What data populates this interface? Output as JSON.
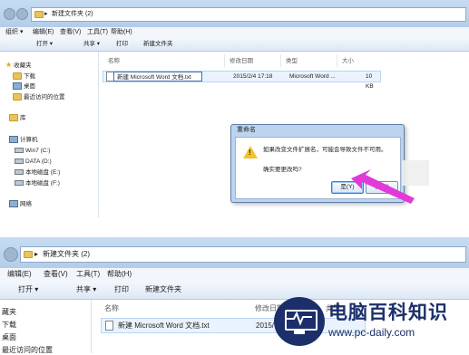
{
  "top": {
    "breadcrumb": "新建文件夹 (2)",
    "menu": [
      "组织 ▾",
      "编辑(E)",
      "查看(V)",
      "工具(T)",
      "帮助(H)"
    ],
    "toolbar": {
      "open": "打开 ▾",
      "share": "共享 ▾",
      "print": "打印",
      "new_folder": "新建文件夹"
    },
    "sidebar": {
      "favorites": "收藏夹",
      "downloads": "下载",
      "desktop": "桌面",
      "recent": "最近访问的位置",
      "libraries": "库",
      "computer": "计算机",
      "drive_c": "Win7 (C:)",
      "drive_d": "DATA (D:)",
      "drive_e": "本地磁盘 (E:)",
      "drive_f": "本地磁盘 (F:)",
      "network": "网络"
    },
    "columns": {
      "name": "名称",
      "modified": "修改日期",
      "type": "类型",
      "size": "大小"
    },
    "file": {
      "name": "新建 Microsoft Word 文档.txt",
      "modified": "2015/2/4 17:18",
      "type": "Microsoft Word ...",
      "size": "10 KB"
    },
    "dialog": {
      "title": "重命名",
      "message": "如果改变文件扩展名，可能会导致文件不可用。",
      "question": "确实要更改吗?",
      "yes": "是(Y)",
      "no": "否(N)"
    }
  },
  "bottom": {
    "breadcrumb": "新建文件夹 (2)",
    "menu": [
      "编辑(E)",
      "查看(V)",
      "工具(T)",
      "帮助(H)"
    ],
    "toolbar": {
      "open": "打开 ▾",
      "share": "共享 ▾",
      "print": "打印",
      "new_folder": "新建文件夹"
    },
    "sidebar": {
      "favorites": "藏夹",
      "downloads": "下载",
      "desktop": "桌面",
      "recent": "最近访问的位置"
    },
    "columns": {
      "name": "名称",
      "modified": "修改日期",
      "type": "类型"
    },
    "file": {
      "name": "新建 Microsoft Word 文档.txt",
      "modified": "2015/"
    }
  },
  "watermark": {
    "title": "电脑百科知识",
    "url": "www.pc-daily.com"
  },
  "colors": {
    "arrow": "#e13ad9",
    "watermark": "#1c2f6a",
    "titlebar": "#c7dcf2"
  }
}
